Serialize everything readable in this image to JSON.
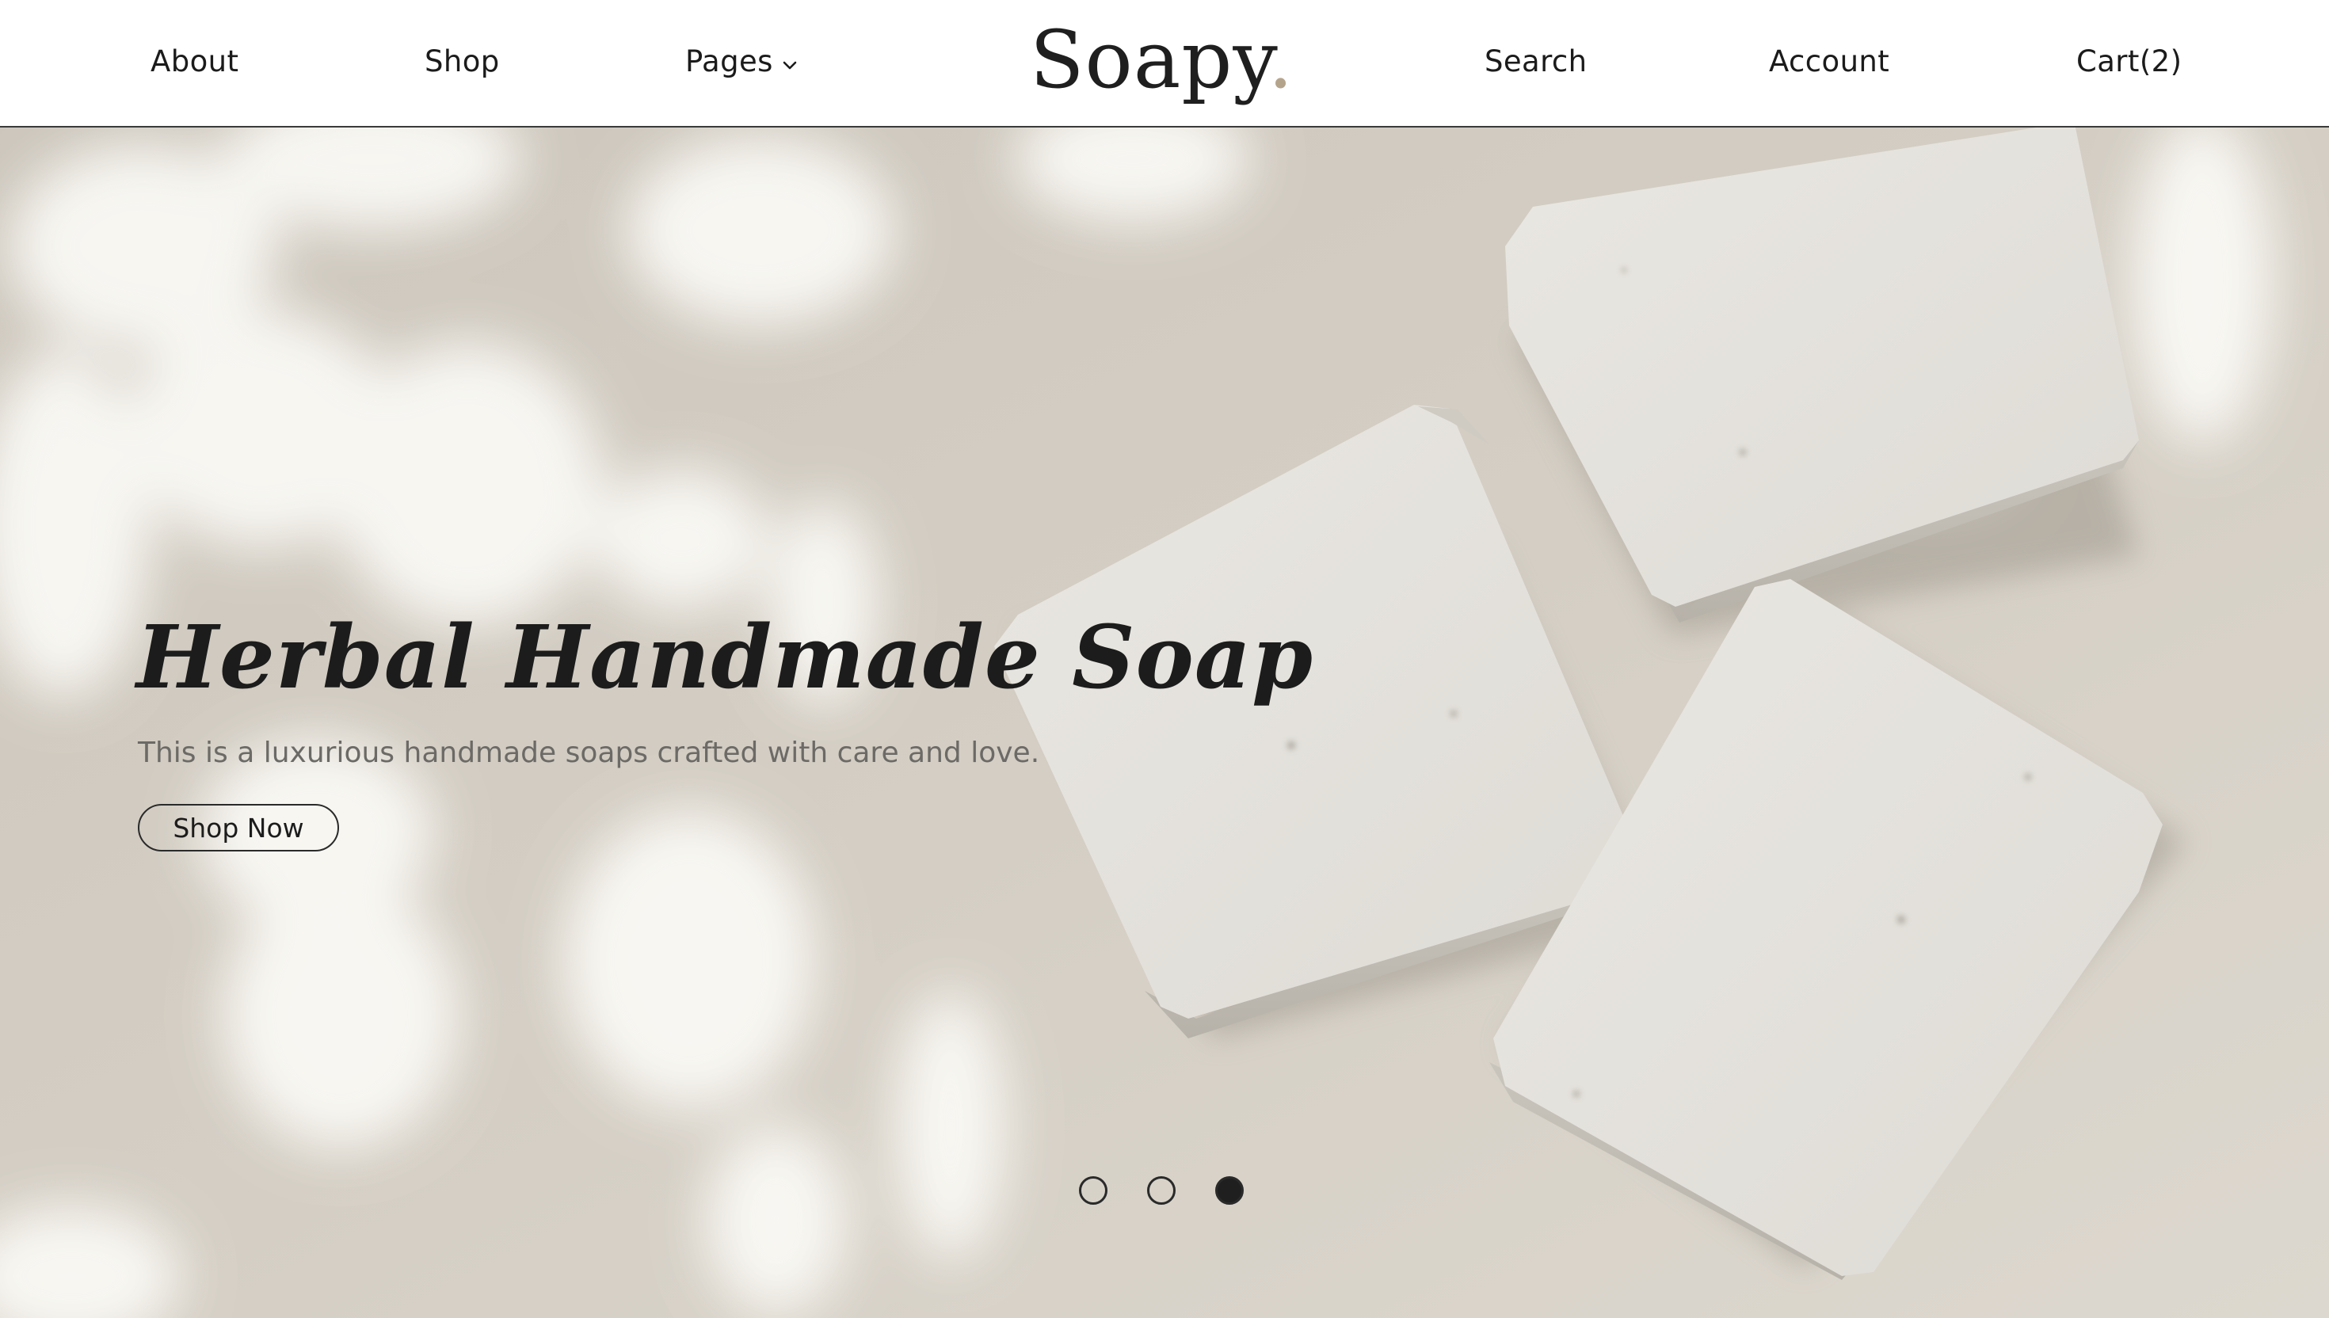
{
  "header": {
    "nav_left": {
      "about": "About",
      "shop": "Shop",
      "pages": "Pages"
    },
    "logo": {
      "text": "Soapy",
      "dot": "."
    },
    "nav_right": {
      "search": "Search",
      "account": "Account",
      "cart": "Cart",
      "cart_count": "(2)"
    }
  },
  "hero": {
    "title": "Herbal Handmade Soap",
    "subtitle": "This is a luxurious handmade soaps crafted with care and love.",
    "cta": "Shop Now",
    "slides": {
      "count": 3,
      "active_index": 2
    }
  },
  "colors": {
    "background": "#ffffff",
    "hero_bg": "#d3cdc3",
    "soap": "#e4e1db",
    "text": "#1c1c1c",
    "muted_text": "#6c6a66",
    "logo_accent": "#b5a48c"
  },
  "icons": {
    "pages_dropdown": "chevron-down-icon"
  }
}
